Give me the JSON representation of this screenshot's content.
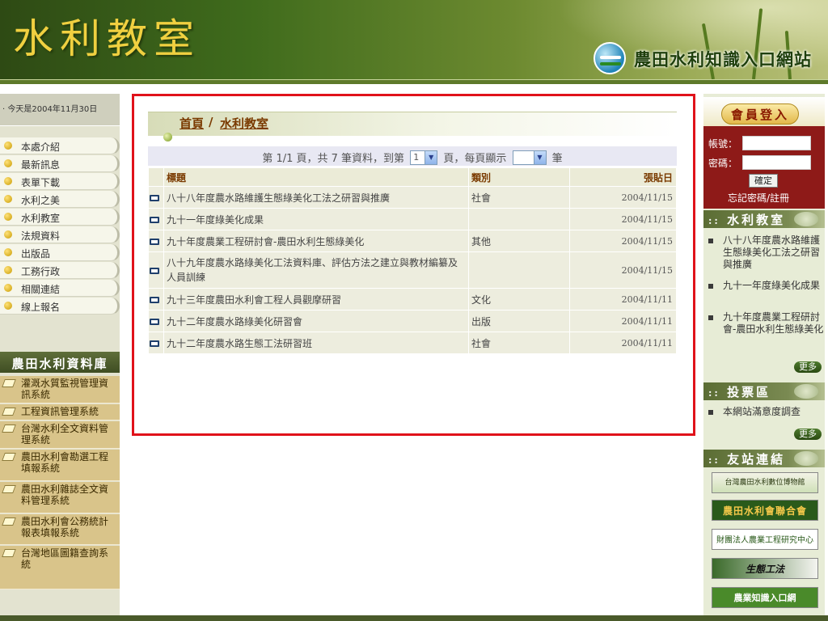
{
  "header": {
    "site_title": "水利教室",
    "portal_title": "農田水利知識入口網站"
  },
  "left_sidebar": {
    "date": "今天是2004年11月30日",
    "nav_items": [
      "本處介紹",
      "最新訊息",
      "表單下載",
      "水利之美",
      "水利教室",
      "法規資料",
      "出版品",
      "工務行政",
      "相關連結",
      "線上報名"
    ],
    "database_title": "農田水利資料庫",
    "database_items": [
      "灌溉水質監視管理資訊系統",
      "工程資訊管理系統",
      "台灣水利全文資料管理系統",
      "農田水利會勘選工程填報系統",
      "農田水利雜誌全文資料管理系統",
      "農田水利會公務統計報表填報系統",
      "台灣地區圖籍查詢系統"
    ]
  },
  "main": {
    "breadcrumb_home": "首頁",
    "breadcrumb_sep": "/",
    "breadcrumb_current": "水利教室",
    "pager": {
      "text1": "第 1/1 頁，共 7 筆資料，到第",
      "page_value": "1",
      "text2": "頁，每頁顯示",
      "per_page_value": "",
      "text3": "筆"
    },
    "columns": [
      "標題",
      "類別",
      "張貼日"
    ],
    "rows": [
      {
        "title": "八十八年度農水路維護生態綠美化工法之研習與推廣",
        "category": "社會",
        "date": "2004/11/15"
      },
      {
        "title": "九十一年度綠美化成果",
        "category": "",
        "date": "2004/11/15"
      },
      {
        "title": "九十年度農業工程研討會-農田水利生態綠美化",
        "category": "其他",
        "date": "2004/11/15"
      },
      {
        "title": "八十九年度農水路綠美化工法資料庫、評估方法之建立與教材編纂及人員訓練",
        "category": "",
        "date": "2004/11/15"
      },
      {
        "title": "九十三年度農田水利會工程人員觀摩研習",
        "category": "文化",
        "date": "2004/11/11"
      },
      {
        "title": "九十二年度農水路綠美化研習會",
        "category": "出版",
        "date": "2004/11/11"
      },
      {
        "title": "九十二年度農水路生態工法研習班",
        "category": "社會",
        "date": "2004/11/11"
      }
    ]
  },
  "right_sidebar": {
    "login_title": "會員登入",
    "account_label": "帳號：",
    "password_label": "密碼：",
    "submit_label": "確定",
    "forgot_text": "忘記密碼/註冊",
    "classroom_title": "水利教室",
    "classroom_items": [
      "八十八年度農水路維護生態綠美化工法之研習與推廣",
      "九十一年度綠美化成果",
      "九十年度農業工程研討會-農田水利生態綠美化"
    ],
    "more_label": "更多",
    "vote_title": "投票區",
    "vote_items": [
      "本網站滿意度調查"
    ],
    "links_title": "友站連結",
    "link_logos": [
      "台灣農田水利數位博物館",
      "農田水利會聯合會",
      "財團法人農業工程研究中心",
      "生態工法",
      "農業知識入口網"
    ]
  },
  "colors": {
    "header_green": "#3f6b1c",
    "title_gold": "#f0d040",
    "highlight_red": "#e0121a",
    "login_red": "#8e1a18",
    "heading_brown": "#7a3a00"
  }
}
